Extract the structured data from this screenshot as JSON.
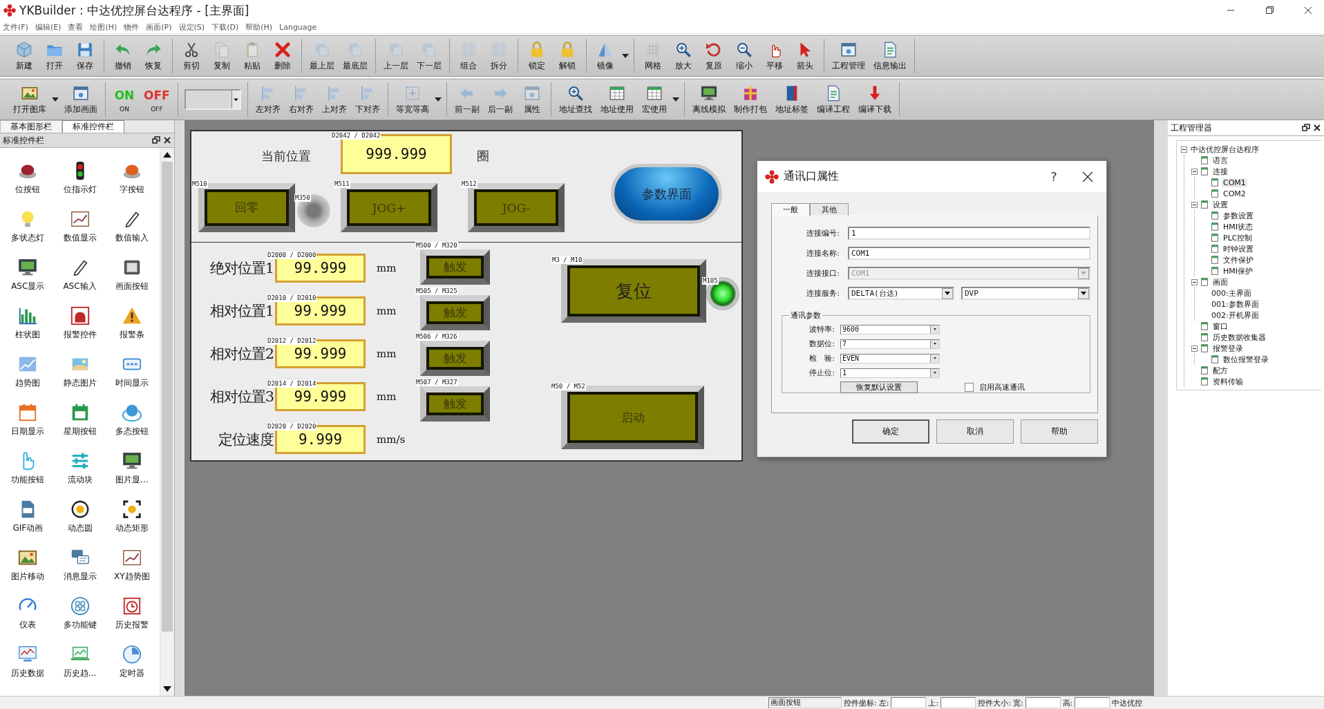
{
  "window": {
    "title": "YKBuilder : 中达优控屏台达程序 - [主界面]"
  },
  "menu": [
    "文件(F)",
    "编辑(E)",
    "查看",
    "绘图(H)",
    "物件",
    "画面(P)",
    "设定(S)",
    "下载(D)",
    "帮助(H)",
    "Language"
  ],
  "toolbar_1": [
    {
      "items": [
        {
          "kind": "button",
          "label": "新建",
          "disabled": false
        },
        {
          "kind": "button",
          "label": "打开",
          "disabled": false
        },
        {
          "kind": "button",
          "label": "保存",
          "disabled": false
        }
      ]
    },
    {
      "items": [
        {
          "kind": "button",
          "label": "撤销",
          "disabled": false
        },
        {
          "kind": "button",
          "label": "恢复",
          "disabled": false
        }
      ]
    },
    {
      "items": [
        {
          "kind": "button",
          "label": "剪切",
          "disabled": false
        },
        {
          "kind": "button",
          "label": "复制",
          "disabled": true
        },
        {
          "kind": "button",
          "label": "粘贴",
          "disabled": true
        },
        {
          "kind": "button",
          "label": "删除",
          "disabled": false
        }
      ]
    },
    {
      "items": [
        {
          "kind": "button",
          "label": "最上层",
          "disabled": true
        },
        {
          "kind": "button",
          "label": "最底层",
          "disabled": true
        }
      ]
    },
    {
      "items": [
        {
          "kind": "button",
          "label": "上一层",
          "disabled": true
        },
        {
          "kind": "button",
          "label": "下一层",
          "disabled": true
        }
      ]
    },
    {
      "items": [
        {
          "kind": "button",
          "label": "组合",
          "disabled": true
        },
        {
          "kind": "button",
          "label": "拆分",
          "disabled": true
        }
      ]
    },
    {
      "items": [
        {
          "kind": "button",
          "label": "锁定",
          "disabled": false
        },
        {
          "kind": "button",
          "label": "解锁",
          "disabled": false
        }
      ]
    },
    {
      "items": [
        {
          "kind": "split",
          "label": "镜像",
          "disabled": false
        }
      ]
    },
    {
      "items": [
        {
          "kind": "button",
          "label": "网格",
          "disabled": true
        },
        {
          "kind": "button",
          "label": "放大",
          "disabled": false
        },
        {
          "kind": "button",
          "label": "复原",
          "disabled": false
        },
        {
          "kind": "button",
          "label": "缩小",
          "disabled": false
        },
        {
          "kind": "button",
          "label": "平移",
          "disabled": false
        },
        {
          "kind": "button",
          "label": "箭头",
          "disabled": false
        }
      ]
    },
    {
      "items": [
        {
          "kind": "button",
          "label": "工程管理",
          "disabled": false
        },
        {
          "kind": "button",
          "label": "信息输出",
          "disabled": false
        }
      ]
    }
  ],
  "toolbar_2": [
    {
      "items": [
        {
          "kind": "split",
          "label": "打开图库",
          "disabled": false
        },
        {
          "kind": "button",
          "label": "添加画面",
          "disabled": false
        }
      ]
    },
    {
      "items": [
        {
          "kind": "switch-on",
          "glyph": "ON",
          "label": "ON"
        },
        {
          "kind": "switch-off",
          "glyph": "OFF",
          "label": "OFF"
        }
      ]
    },
    {
      "items": [
        {
          "kind": "combo"
        }
      ]
    },
    {
      "items": [
        {
          "kind": "button",
          "label": "左对齐",
          "disabled": true
        },
        {
          "kind": "button",
          "label": "右对齐",
          "disabled": true
        },
        {
          "kind": "button",
          "label": "上对齐",
          "disabled": true
        },
        {
          "kind": "button",
          "label": "下对齐",
          "disabled": true
        }
      ]
    },
    {
      "items": [
        {
          "kind": "split",
          "label": "等宽等高",
          "disabled": true
        }
      ]
    },
    {
      "items": [
        {
          "kind": "button",
          "label": "前一副",
          "disabled": true
        },
        {
          "kind": "button",
          "label": "后一副",
          "disabled": true
        },
        {
          "kind": "button",
          "label": "属性",
          "disabled": true
        }
      ]
    },
    {
      "items": [
        {
          "kind": "button",
          "label": "地址查找",
          "disabled": false
        },
        {
          "kind": "button",
          "label": "地址使用",
          "disabled": false
        },
        {
          "kind": "split",
          "label": "宏使用",
          "disabled": false
        }
      ]
    },
    {
      "items": [
        {
          "kind": "button",
          "label": "离线模拟",
          "disabled": false
        },
        {
          "kind": "button",
          "label": "制作打包",
          "disabled": false
        },
        {
          "kind": "button",
          "label": "地址标签",
          "disabled": false
        },
        {
          "kind": "button",
          "label": "编译工程",
          "disabled": false
        },
        {
          "kind": "button",
          "label": "编译下载",
          "disabled": false
        }
      ]
    }
  ],
  "left_panel": {
    "tabs": [
      {
        "label": "基本图形栏",
        "selected": false
      },
      {
        "label": "标准控件栏",
        "selected": true
      }
    ],
    "title": "标准控件栏",
    "widgets": [
      "位按钮",
      "位指示灯",
      "字按钮",
      "多状态灯",
      "数值显示",
      "数值输入",
      "ASC显示",
      "ASC输入",
      "画面按钮",
      "柱状图",
      "报警控件",
      "报警条",
      "趋势图",
      "静态图片",
      "时间显示",
      "日期显示",
      "星期按钮",
      "多态按钮",
      "功能按钮",
      "流动块",
      "图片显…",
      "GIF动画",
      "动态圆",
      "动态矩形",
      "图片移动",
      "消息显示",
      "XY趋势图",
      "仪表",
      "多功能键",
      "历史报警",
      "历史数据",
      "历史趋…",
      "定时器"
    ]
  },
  "canvas": {
    "current_position": {
      "label": "当前位置",
      "tag": "D2042 / D2042",
      "value": "999.999",
      "unit": "圈"
    },
    "top_buttons": [
      {
        "tag": "M510",
        "label": "回零"
      },
      {
        "tag": "M511",
        "label": "JOG+"
      },
      {
        "tag": "M512",
        "label": "JOG-"
      }
    ],
    "home_lamp": {
      "tag": "M350",
      "on": false
    },
    "screen_button": {
      "label": "参数界面"
    },
    "rows": [
      {
        "label": "绝对位置1",
        "tag": "D2000 / D2000",
        "value": "99.999",
        "unit": "mm",
        "trigger": {
          "tag": "M500 / M320",
          "label": "触发"
        }
      },
      {
        "label": "相对位置1",
        "tag": "D2010 / D2010",
        "value": "99.999",
        "unit": "mm",
        "trigger": {
          "tag": "M505 / M325",
          "label": "触发"
        }
      },
      {
        "label": "相对位置2",
        "tag": "D2012 / D2012",
        "value": "99.999",
        "unit": "mm",
        "trigger": {
          "tag": "M506 / M326",
          "label": "触发"
        }
      },
      {
        "label": "相对位置3",
        "tag": "D2014 / D2014",
        "value": "99.999",
        "unit": "mm",
        "trigger": {
          "tag": "M507 / M327",
          "label": "触发"
        }
      },
      {
        "label": "定位速度",
        "tag": "D2020 / D2020",
        "value": "9.999",
        "unit": "mm/s"
      }
    ],
    "reset_button": {
      "tag": "M3 / M10",
      "label": "复位"
    },
    "reset_lamp": {
      "tag": "M105",
      "on": true
    },
    "start_button": {
      "tag": "M50 / M52",
      "label": "启动"
    }
  },
  "dialog": {
    "title": "通讯口属性",
    "help": "?",
    "tabs": [
      {
        "label": "一般",
        "selected": true
      },
      {
        "label": "其他",
        "selected": false
      }
    ],
    "fields": [
      {
        "kind": "text",
        "label": "连接编号:",
        "value": "1",
        "disabled": false
      },
      {
        "kind": "text",
        "label": "连接名称:",
        "value": "COM1",
        "disabled": false
      },
      {
        "kind": "select",
        "label": "连接接口:",
        "value": "COM1",
        "disabled": true
      },
      {
        "kind": "double-select",
        "label": "连接服务:",
        "value": "DELTA(台达)",
        "value_2": "DVP",
        "disabled": false
      }
    ],
    "group": {
      "title": "通讯参数",
      "params": [
        {
          "label": "波特率:",
          "value": "9600"
        },
        {
          "label": "数据位:",
          "value": "7"
        },
        {
          "label": "检　验:",
          "value": "EVEN"
        },
        {
          "label": "停止位:",
          "value": "1"
        }
      ],
      "reset_button": "恢复默认设置",
      "high_speed": {
        "label": "启用高速通讯",
        "checked": false
      }
    },
    "buttons": [
      "确定",
      "取消",
      "帮助"
    ]
  },
  "right_panel": {
    "title": "工程管理器",
    "tree": {
      "label": "中达优控屏台达程序",
      "selected": false,
      "expanded": true,
      "children": [
        {
          "label": "语言",
          "kind": "item",
          "selected": false
        },
        {
          "label": "连接",
          "kind": "item",
          "selected": false,
          "expanded": true,
          "children": [
            {
              "label": "COM1",
              "kind": "item",
              "selected": true
            },
            {
              "label": "COM2",
              "kind": "item",
              "selected": false
            }
          ]
        },
        {
          "label": "设置",
          "kind": "item",
          "selected": false,
          "expanded": true,
          "children": [
            {
              "label": "参数设置",
              "kind": "item",
              "selected": false
            },
            {
              "label": "HMI状态",
              "kind": "item",
              "selected": false
            },
            {
              "label": "PLC控制",
              "kind": "item",
              "selected": false
            },
            {
              "label": "时钟设置",
              "kind": "item",
              "selected": false
            },
            {
              "label": "文件保护",
              "kind": "item",
              "selected": false
            },
            {
              "label": "HMI保护",
              "kind": "item",
              "selected": false
            }
          ]
        },
        {
          "label": "画面",
          "kind": "item",
          "selected": false,
          "expanded": true,
          "children": [
            {
              "label": "000:主界面",
              "kind": "screen",
              "selected": false
            },
            {
              "label": "001:参数界面",
              "kind": "screen",
              "selected": false
            },
            {
              "label": "002:开机界面",
              "kind": "screen",
              "selected": false
            }
          ]
        },
        {
          "label": "窗口",
          "kind": "item",
          "selected": false
        },
        {
          "label": "历史数据收集器",
          "kind": "item",
          "selected": false
        },
        {
          "label": "报警登录",
          "kind": "item",
          "selected": false,
          "expanded": true,
          "children": [
            {
              "label": "数位报警登录",
              "kind": "item",
              "selected": false
            }
          ]
        },
        {
          "label": "配方",
          "kind": "item",
          "selected": false
        },
        {
          "label": "资料传输",
          "kind": "item",
          "selected": false
        }
      ]
    }
  },
  "status_bar": {
    "selection": "画面按钮",
    "position_label": "控件坐标:",
    "left_label": "左:",
    "top_label": "上:",
    "size_label": "控件大小:",
    "width_label": "宽:",
    "height_label": "高:",
    "company": "中达优控"
  }
}
